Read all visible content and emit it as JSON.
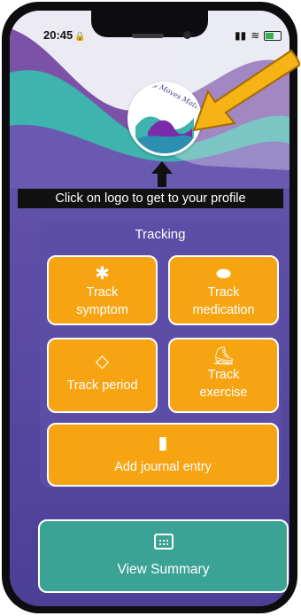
{
  "status_bar": {
    "time": "20:45",
    "lock_glyph": "🔒",
    "signal": "▮▮",
    "wifi": "≋"
  },
  "logo": {
    "text": "My Moves Matter",
    "alt": "profile-logo"
  },
  "callout": {
    "text": "Click on logo to get to your profile"
  },
  "tracking": {
    "title": "Tracking",
    "tiles": [
      {
        "icon": "asterisk-icon",
        "glyph": "✱",
        "label_line1": "Track",
        "label_line2": "symptom"
      },
      {
        "icon": "pills-icon",
        "glyph": "⬬",
        "label_line1": "Track",
        "label_line2": "medication"
      },
      {
        "icon": "drop-icon",
        "glyph": "◇",
        "label_line1": "",
        "label_line2": "Track period"
      },
      {
        "icon": "shoe-icon",
        "glyph": "⛸",
        "label_line1": "Track",
        "label_line2": "exercise"
      },
      {
        "icon": "journal-icon",
        "glyph": "▮",
        "label_line1": "",
        "label_line2": "Add journal entry"
      }
    ]
  },
  "summary": {
    "label": "View Summary",
    "icon": "calendar-icon"
  },
  "colors": {
    "tile": "#f7a413",
    "summary": "#3aa396",
    "background": "#5a4aa3",
    "callout": "#111111",
    "annotation_arrow": "#f5b316"
  }
}
